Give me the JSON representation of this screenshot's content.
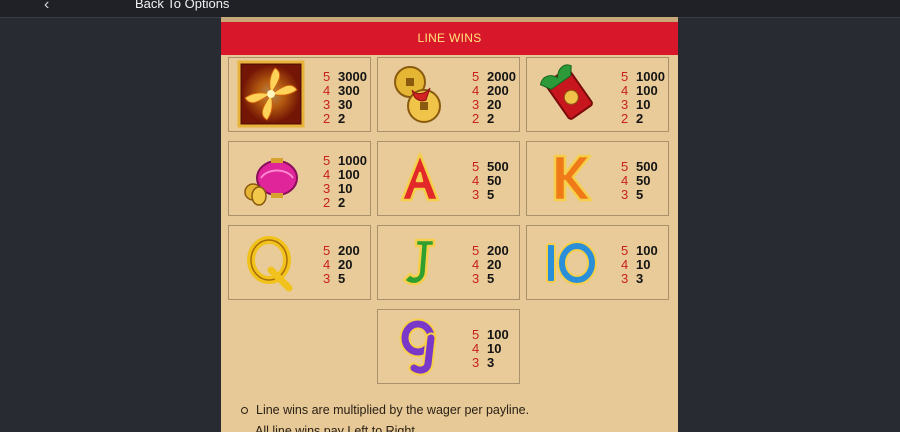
{
  "nav": {
    "back_label": "Back To Options"
  },
  "paytable": {
    "title": "LINE WINS",
    "symbols": [
      {
        "name": "pinwheel",
        "pays": [
          [
            "5",
            "3000"
          ],
          [
            "4",
            "300"
          ],
          [
            "3",
            "30"
          ],
          [
            "2",
            "2"
          ]
        ]
      },
      {
        "name": "gold-coins",
        "pays": [
          [
            "5",
            "2000"
          ],
          [
            "4",
            "200"
          ],
          [
            "3",
            "20"
          ],
          [
            "2",
            "2"
          ]
        ]
      },
      {
        "name": "red-envelope",
        "pays": [
          [
            "5",
            "1000"
          ],
          [
            "4",
            "100"
          ],
          [
            "3",
            "10"
          ],
          [
            "2",
            "2"
          ]
        ]
      },
      {
        "name": "lantern",
        "pays": [
          [
            "5",
            "1000"
          ],
          [
            "4",
            "100"
          ],
          [
            "3",
            "10"
          ],
          [
            "2",
            "2"
          ]
        ]
      },
      {
        "name": "letter-a",
        "pays": [
          [
            "5",
            "500"
          ],
          [
            "4",
            "50"
          ],
          [
            "3",
            "5"
          ]
        ]
      },
      {
        "name": "letter-k",
        "pays": [
          [
            "5",
            "500"
          ],
          [
            "4",
            "50"
          ],
          [
            "3",
            "5"
          ]
        ]
      },
      {
        "name": "letter-q",
        "pays": [
          [
            "5",
            "200"
          ],
          [
            "4",
            "20"
          ],
          [
            "3",
            "5"
          ]
        ]
      },
      {
        "name": "letter-j",
        "pays": [
          [
            "5",
            "200"
          ],
          [
            "4",
            "20"
          ],
          [
            "3",
            "5"
          ]
        ]
      },
      {
        "name": "number-10",
        "pays": [
          [
            "5",
            "100"
          ],
          [
            "4",
            "10"
          ],
          [
            "3",
            "3"
          ]
        ]
      },
      {
        "name": "number-9",
        "pays": [
          [
            "5",
            "100"
          ],
          [
            "4",
            "10"
          ],
          [
            "3",
            "3"
          ]
        ]
      }
    ]
  },
  "rules": [
    "Line wins are multiplied by the wager per payline.",
    "All line wins pay Left to Right."
  ],
  "colors": {
    "header_bg": "#d9172a",
    "header_text": "#ffe27a",
    "panel_bg": "#e6c996",
    "count_color": "#c8201f"
  }
}
